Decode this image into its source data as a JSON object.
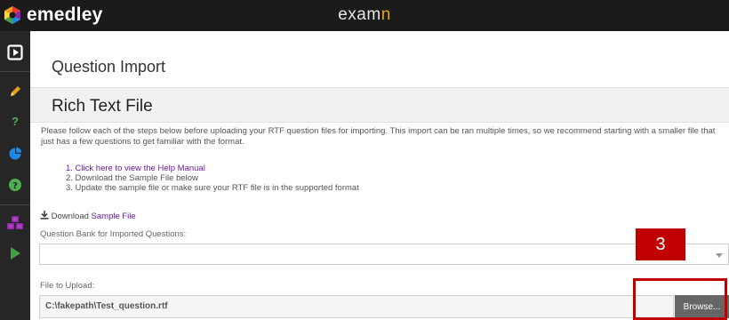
{
  "app": {
    "brand": "emedley",
    "product_prefix": "exam",
    "product_suffix": "n"
  },
  "sidebar": {
    "items": [
      {
        "icon": "play-square-icon",
        "color": "#ffffff"
      },
      {
        "icon": "pencil-icon",
        "color": "#e8a317"
      },
      {
        "icon": "question-mark-icon",
        "color": "#4caf50"
      },
      {
        "icon": "pie-chart-icon",
        "color": "#1e88e5"
      },
      {
        "icon": "help-circle-icon",
        "color": "#4caf50"
      },
      {
        "icon": "cubes-icon",
        "color": "#8e24aa"
      },
      {
        "icon": "play-triangle-icon",
        "color": "#43a047"
      }
    ]
  },
  "page": {
    "title": "Question Import",
    "section_title": "Rich Text File",
    "intro": "Please follow each of the steps below before uploading your RTF question files for importing. This import can be ran multiple times, so we recommend starting with a smaller file that just has a few questions to get familiar with the format.",
    "steps": [
      "1. Click here to view the Help Manual",
      "2. Download the Sample File below",
      "3. Update the sample file or make sure your RTF file is in the supported format"
    ],
    "download_prefix": "Download",
    "download_link": "Sample File",
    "bank_label": "Question Bank for Imported Questions:",
    "bank_value": "",
    "file_label": "File to Upload:",
    "file_value": "C:\\fakepath\\Test_question.rtf",
    "browse_label": "Browse..."
  },
  "annotation": {
    "badge": "3",
    "color": "#c00000"
  }
}
